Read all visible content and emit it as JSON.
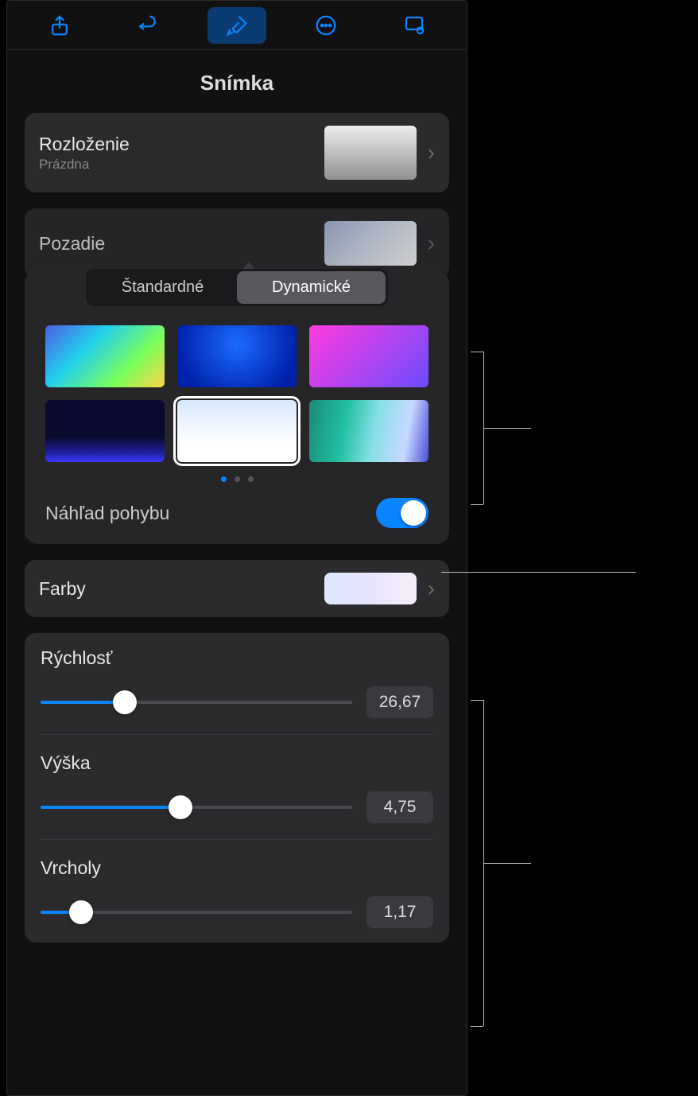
{
  "panel": {
    "title": "Snímka"
  },
  "layout": {
    "label": "Rozloženie",
    "sublabel": "Prázdna"
  },
  "background": {
    "label": "Pozadie",
    "segmented": {
      "standard": "Štandardné",
      "dynamic": "Dynamické"
    },
    "motion_preview_label": "Náhľad pohybu"
  },
  "colors": {
    "label": "Farby"
  },
  "sliders": {
    "speed": {
      "label": "Rýchlosť",
      "value": "26,67",
      "percent": 27
    },
    "height": {
      "label": "Výška",
      "value": "4,75",
      "percent": 45
    },
    "peaks": {
      "label": "Vrcholy",
      "value": "1,17",
      "percent": 13
    }
  }
}
